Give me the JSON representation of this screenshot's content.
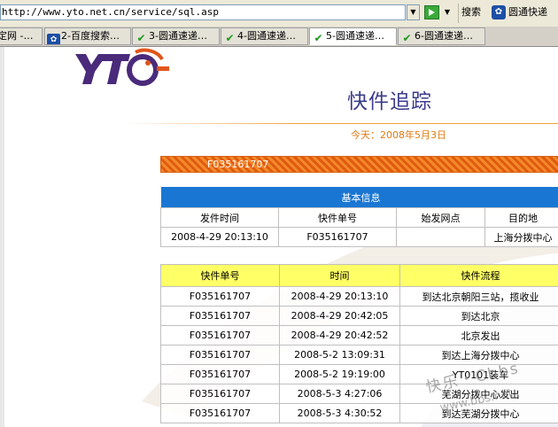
{
  "browser": {
    "url": "http://www.yto.net.cn/service/sql.asp",
    "search_label": "搜索",
    "search_site_label": "圆通快递"
  },
  "tabs": [
    {
      "label": "定网 -…",
      "icon": "page-icon"
    },
    {
      "label": "2-百度搜索…",
      "icon": "baidu-paw-icon"
    },
    {
      "label": "3-圆通速递…",
      "icon": "check-icon"
    },
    {
      "label": "4-圆通速递…",
      "icon": "check-icon"
    },
    {
      "label": "5-圆通速递…",
      "icon": "check-icon",
      "active": true
    },
    {
      "label": "6-圆通速递…",
      "icon": "check-icon"
    }
  ],
  "page": {
    "title": "快件追踪",
    "today": "今天：2008年5月3日",
    "tracking_number": "F035161707"
  },
  "basic_info": {
    "header": "基本信息",
    "columns": [
      "发件时间",
      "快件单号",
      "始发网点",
      "目的地"
    ],
    "row": [
      "2008-4-29 20:13:10",
      "F035161707",
      "",
      "上海分拨中心"
    ]
  },
  "flow_table": {
    "columns": [
      "快件单号",
      "时间",
      "快件流程"
    ],
    "rows": [
      [
        "F035161707",
        "2008-4-29 20:13:10",
        "到达北京朝阳三站，揽收业"
      ],
      [
        "F035161707",
        "2008-4-29 20:42:05",
        "到达北京"
      ],
      [
        "F035161707",
        "2008-4-29 20:42:52",
        "北京发出"
      ],
      [
        "F035161707",
        "2008-5-2 13:09:31",
        "到达上海分拨中心"
      ],
      [
        "F035161707",
        "2008-5-2 19:19:00",
        "YT0101装车"
      ],
      [
        "F035161707",
        "2008-5-3 4:27:06",
        "芜湖分拨中心发出"
      ],
      [
        "F035161707",
        "2008-5-3 4:30:52",
        "到达芜湖分拨中心"
      ]
    ]
  },
  "watermark": {
    "line1": "快乐・Cbbs",
    "line2": "www.bbs.net"
  },
  "colors": {
    "accent_blue": "#1976d2",
    "header_yellow": "#ffff66",
    "orange": "#e07a10",
    "title_purple": "#3c3c8c"
  }
}
